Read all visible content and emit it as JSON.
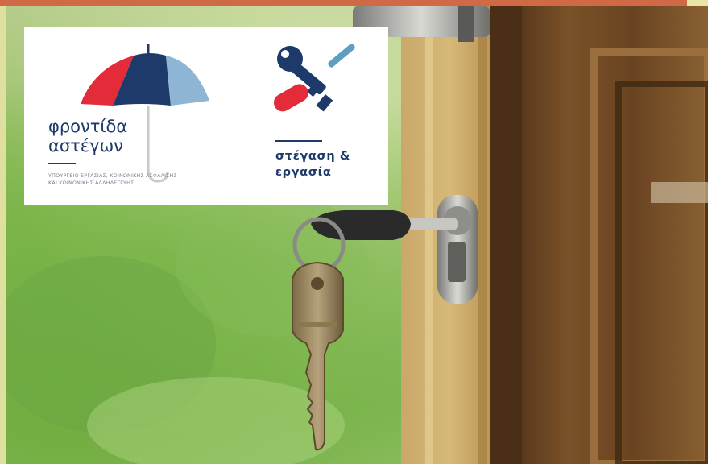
{
  "image": {
    "description_elements": [
      "door",
      "key-in-lock",
      "keyring",
      "blurred-greenery"
    ],
    "frame": {
      "top_bar_color": "#d06a46",
      "corner_color": "#e7e6a8",
      "margin_color": "#dfe0a0"
    }
  },
  "logos": {
    "frontida": {
      "title": "φροντίδα\nαστέγων",
      "subtitle": "ΥΠΟΥΡΓΕΙΟ ΕΡΓΑΣΙΑΣ, ΚΟΙΝΩΝΙΚΗΣ ΑΣΦΑΛΙΣΗΣ\nΚΑΙ ΚΟΙΝΩΝΙΚΗΣ ΑΛΛΗΛΕΓΓΥΗΣ",
      "icon": "umbrella-icon",
      "colors": {
        "navy": "#1d3a6b",
        "red": "#e32b3a",
        "light_blue": "#8fb5d4",
        "grey": "#c9c9cc"
      }
    },
    "stegasi": {
      "title": "στέγαση &\nεργασία",
      "icon": "key-icon",
      "colors": {
        "navy": "#1d3a6b",
        "red": "#e32b3a",
        "teal": "#5d9fc0"
      }
    }
  }
}
